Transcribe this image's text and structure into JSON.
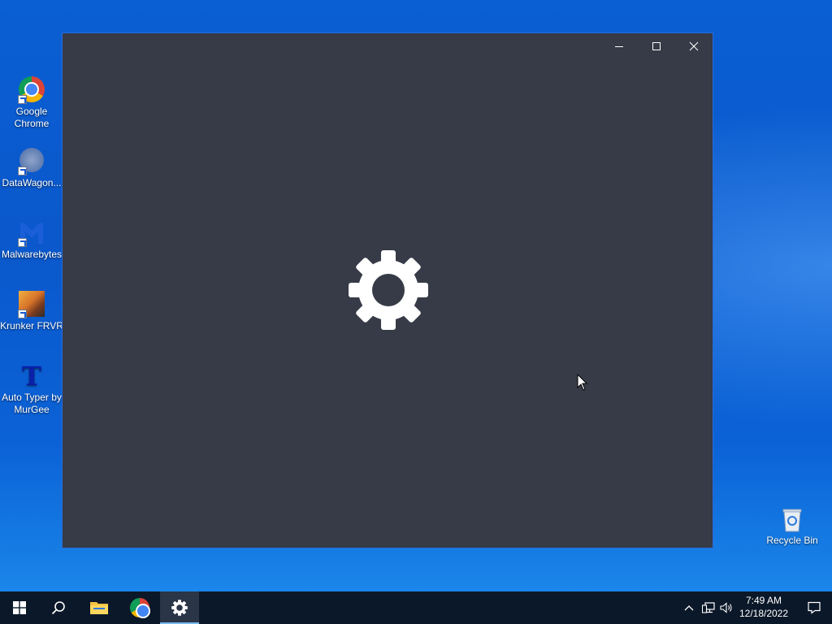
{
  "desktop": {
    "icons": [
      {
        "label_line1": "Google",
        "label_line2": "Chrome",
        "icon": "chrome-icon"
      },
      {
        "label_line1": "DataWagon...",
        "icon": "datawagon-icon"
      },
      {
        "label_line1": "Malwarebytes",
        "icon": "malwarebytes-icon"
      },
      {
        "label_line1": "Krunker FRVR",
        "icon": "krunker-icon"
      },
      {
        "label_line1": "Auto Typer by",
        "label_line2": "MurGee",
        "icon": "auto-typer-icon"
      }
    ],
    "recycle_bin": {
      "label": "Recycle Bin",
      "icon": "recycle-bin-icon"
    }
  },
  "window": {
    "app": "Settings",
    "splash_icon": "gear-icon",
    "background_color": "#363b47",
    "controls": {
      "minimize": "minimize-icon",
      "maximize": "maximize-icon",
      "close": "close-icon"
    }
  },
  "taskbar": {
    "items": [
      {
        "name": "start",
        "icon": "windows-logo-icon"
      },
      {
        "name": "search",
        "icon": "search-icon"
      },
      {
        "name": "file-explorer",
        "icon": "folder-icon"
      },
      {
        "name": "chrome",
        "icon": "chrome-icon"
      },
      {
        "name": "settings",
        "icon": "gear-icon",
        "active": true
      }
    ],
    "tray": {
      "icons": [
        "chevron-up-icon",
        "network-icon",
        "volume-icon"
      ],
      "time": "7:49 AM",
      "date": "12/18/2022",
      "notification_icon": "action-center-icon"
    }
  },
  "colors": {
    "taskbar": "#0b1829",
    "accent": "#76b9ed",
    "desktop_blue": "#0a5fd3"
  }
}
